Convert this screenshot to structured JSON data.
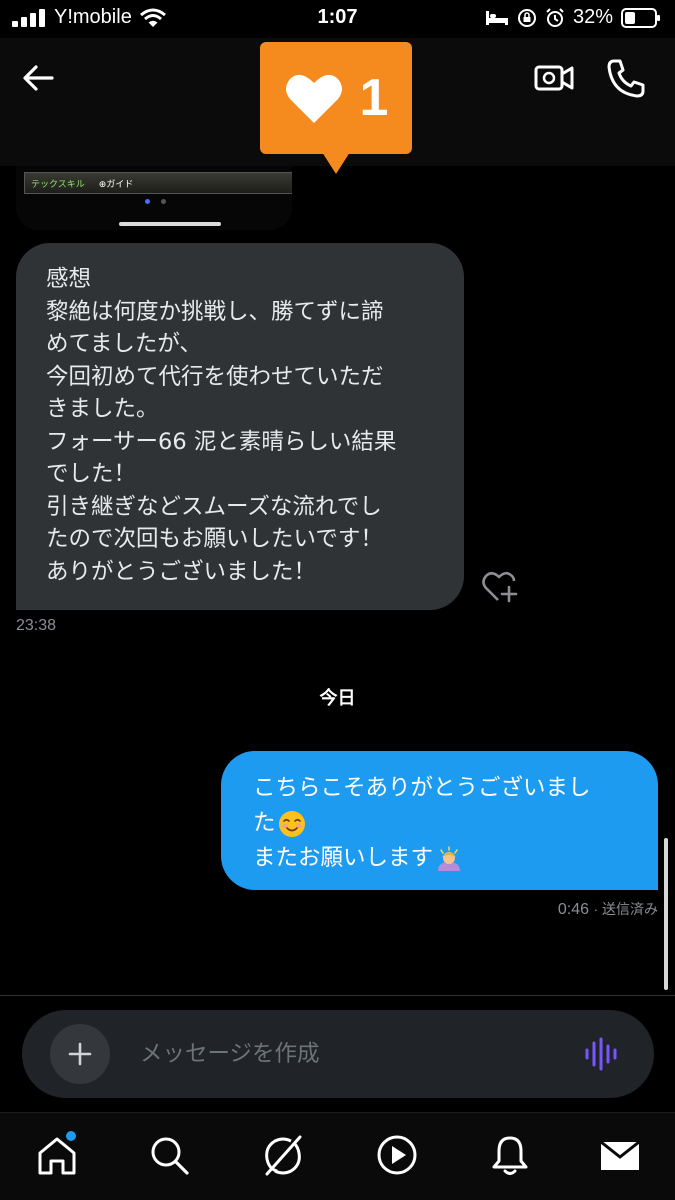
{
  "status_bar": {
    "carrier": "Y!mobile",
    "time": "1:07",
    "battery": "32%"
  },
  "header": {
    "back_icon": "arrow-left-icon",
    "video_icon": "video-call-icon",
    "phone_icon": "phone-icon"
  },
  "like_toast": {
    "icon": "heart-icon",
    "count": "1",
    "color": "#f58b1f"
  },
  "image_preview": {
    "tab1": "テックスキル",
    "tab2": "⊕ガイド"
  },
  "received": {
    "lines": [
      "感想",
      "黎絶は何度か挑戦し、勝てずに諦",
      "めてましたが、",
      "今回初めて代行を使わせていただ",
      "きました。",
      "フォーサー66 泥と素晴らしい結果",
      "でした！",
      "引き継ぎなどスムーズな流れでし",
      "たので次回もお願いしたいです！",
      "ありがとうございました！"
    ],
    "time": "23:38",
    "bubble_color": "#2f3336"
  },
  "date_separator": "今日",
  "sent": {
    "line1": "こちらこそありがとうございまし",
    "line2": "た",
    "line3": "またお願いします",
    "emoji1": "smiling-face-icon",
    "emoji2": "bowing-person-icon",
    "time": "0:46",
    "status": "· 送信済み",
    "bubble_color": "#1d9bf0"
  },
  "composer": {
    "placeholder": "メッセージを作成",
    "add_icon": "plus-icon",
    "voice_icon": "voice-wave-icon"
  },
  "nav": {
    "items": [
      "home-icon",
      "search-icon",
      "grok-icon",
      "video-play-icon",
      "bell-icon",
      "mail-icon"
    ]
  }
}
